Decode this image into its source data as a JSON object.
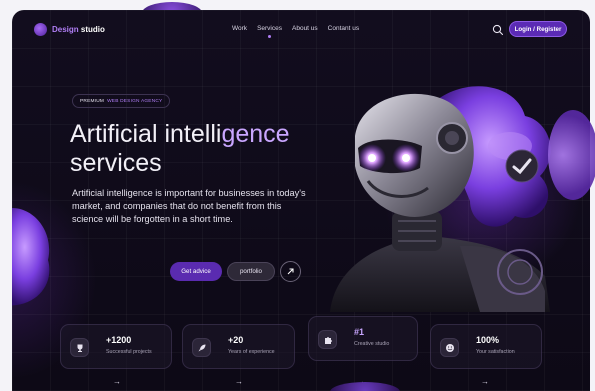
{
  "brand": {
    "name_part1": "Design",
    "name_part2": " studio"
  },
  "nav": {
    "links": [
      {
        "label": "Work"
      },
      {
        "label": "Services"
      },
      {
        "label": "About us"
      },
      {
        "label": "Contant us"
      }
    ],
    "active_index": 1,
    "login_label": "Login / Register"
  },
  "hero": {
    "badge_part1": "PREMIUM",
    "badge_part2": "WEB DESIGN AGENCY",
    "title_part1": "Artificial intelli",
    "title_part2": "gence",
    "title_line2": "services",
    "description": "Artificial intelligence is important for businesses in today's market, and companies that do not benefit from this science will be forgotten in a short time.",
    "cta_primary": "Get advice",
    "cta_secondary": "portfolio"
  },
  "stats": [
    {
      "value": "+1200",
      "label": "Successful projects",
      "icon": "trophy-icon"
    },
    {
      "value": "+20",
      "label": "Years of experience",
      "icon": "rocket-icon"
    },
    {
      "value": "#1",
      "label": "Creative studio",
      "icon": "puzzle-icon"
    },
    {
      "value": "100%",
      "label": "Your satisfaction",
      "icon": "smile-icon"
    }
  ],
  "arrow_glyph": "→",
  "colors": {
    "accent": "#b07ef5",
    "primary_button": "#5a2bb0",
    "background": "#0d0916"
  }
}
